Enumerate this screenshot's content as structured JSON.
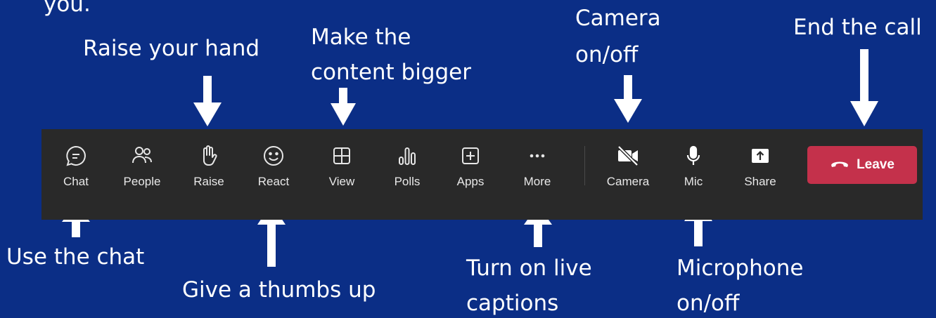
{
  "annotations": {
    "top_partial": "you.",
    "raise_hand": "Raise your hand",
    "make_bigger_line1": "Make the",
    "make_bigger_line2": "content bigger",
    "camera_line1": "Camera",
    "camera_line2": "on/off",
    "end_call": "End the call",
    "use_chat": "Use the chat",
    "thumbs_up": "Give a thumbs up",
    "captions_line1": "Turn on live",
    "captions_line2": "captions",
    "microphone_line1": "Microphone",
    "microphone_line2": "on/off"
  },
  "toolbar": {
    "buttons": [
      {
        "label": "Chat",
        "icon": "chat-icon"
      },
      {
        "label": "People",
        "icon": "people-icon"
      },
      {
        "label": "Raise",
        "icon": "hand-icon"
      },
      {
        "label": "React",
        "icon": "smiley-icon"
      },
      {
        "label": "View",
        "icon": "grid-icon"
      },
      {
        "label": "Polls",
        "icon": "polls-icon"
      },
      {
        "label": "Apps",
        "icon": "plus-box-icon"
      },
      {
        "label": "More",
        "icon": "ellipsis-icon"
      },
      {
        "label": "Camera",
        "icon": "camera-off-icon"
      },
      {
        "label": "Mic",
        "icon": "mic-icon"
      },
      {
        "label": "Share",
        "icon": "share-icon"
      }
    ],
    "leave_label": "Leave",
    "colors": {
      "background": "#292929",
      "leave": "#c4314b",
      "page": "#0b2e86"
    }
  }
}
